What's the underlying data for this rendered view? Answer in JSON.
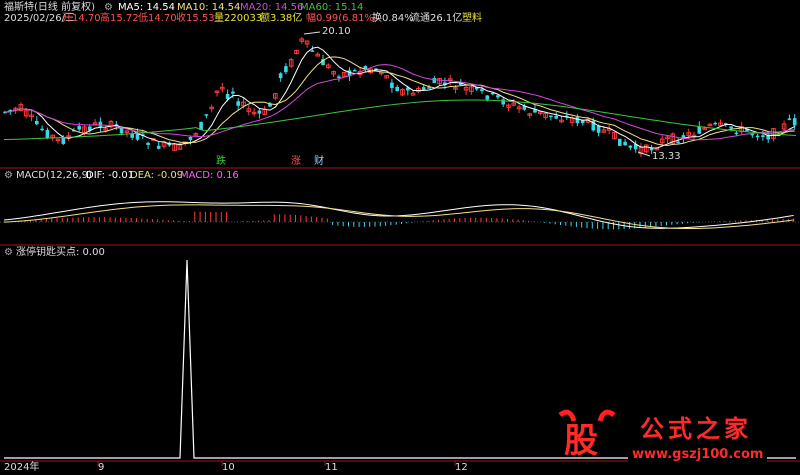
{
  "header": {
    "stock_name": "福斯特(日线 前复权)",
    "ma5": "MA5: 14.54",
    "ma10": "MA10: 14.54",
    "ma20": "MA20: 14.56",
    "ma60": "MA60: 15.14",
    "date_line": "2025/02/26/三",
    "open": "开14.70",
    "high": "高15.72",
    "low": "低14.70",
    "close": "收15.53",
    "volume": "量220033",
    "amount": "额3.38亿",
    "change": "幅0.99(6.81%)",
    "turnover": "换0.84%",
    "float": "流通26.1亿",
    "sector": "塑料"
  },
  "price_panel": {
    "high_label": "20.10",
    "low_label": "13.33",
    "marker_die": "跌",
    "marker_zhang": "涨",
    "marker_cai": "财"
  },
  "macd_panel": {
    "title": "MACD(12,26,9)",
    "dif": "DIF: -0.01",
    "dea": "DEA: -0.09",
    "macd": "MACD: 0.16"
  },
  "indicator_panel": {
    "title": "涨停钥匙",
    "value": "买点: 0.00"
  },
  "x_axis": {
    "labels": [
      "2024年",
      "9",
      "10",
      "11",
      "12"
    ]
  },
  "watermark": {
    "logo_char": "股",
    "brand": "公式之家",
    "url": "www.gszj100.com"
  },
  "colors": {
    "up": "#ff3a3a",
    "down": "#3ad6e6",
    "ma5": "#ffffff",
    "ma10": "#f0e08a",
    "ma20": "#d04ad8",
    "ma60": "#3ec43e",
    "header_red": "#ff5050",
    "header_green": "#30d030",
    "header_yellow": "#e8e040",
    "header_magenta": "#ff60ff"
  }
}
